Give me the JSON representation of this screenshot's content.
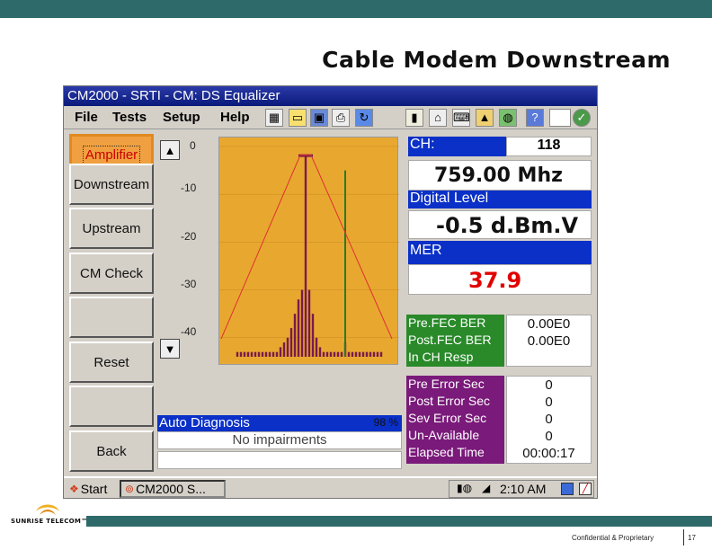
{
  "slide": {
    "title": "Cable Modem Downstream",
    "logo_text": "SUNRISE TELECOM™",
    "confidential": "Confidential & Proprietary",
    "page_number": "17"
  },
  "window": {
    "title": "CM2000 - SRTI - CM: DS Equalizer"
  },
  "menu": {
    "items": [
      "File",
      "Tests",
      "Setup",
      "Help"
    ]
  },
  "toolbar_icons": [
    "calculator-icon",
    "open-folder-icon",
    "save-disk-icon",
    "printer-icon",
    "refresh-icon",
    "chart-icon",
    "network-icon",
    "keyboard-icon",
    "lock-icon",
    "globe-icon",
    "help-icon",
    "checkmark-icon"
  ],
  "sidebar": {
    "buttons": [
      {
        "label": "Amplifier",
        "active": true
      },
      {
        "label": "Downstream"
      },
      {
        "label": "Upstream"
      },
      {
        "label": "CM Check"
      },
      {
        "label": ""
      },
      {
        "label": "Reset"
      },
      {
        "label": ""
      },
      {
        "label": "Back"
      }
    ]
  },
  "chart": {
    "y_ticks": [
      "0",
      "-10",
      "-20",
      "-30",
      "-40"
    ],
    "scroll_up": "▲",
    "scroll_down": "▼"
  },
  "chart_data": {
    "type": "bar",
    "ylim": [
      -44,
      0
    ],
    "ytick_values": [
      0,
      -10,
      -20,
      -30,
      -40
    ],
    "bar_color": "#7a1a4a",
    "marker_color": "#2a7a2a",
    "line_color": "#e03030",
    "values": [
      -43,
      -43,
      -43,
      -43,
      -43,
      -43,
      -43,
      -43,
      -43,
      -43,
      -43,
      -43,
      -42,
      -41,
      -40,
      -38,
      -35,
      -32,
      -30,
      -2,
      -30,
      -35,
      -40,
      -42,
      -43,
      -43,
      -43,
      -43,
      -43,
      -43,
      -41,
      -43,
      -43,
      -43,
      -43,
      -43,
      -43,
      -43,
      -43,
      -43,
      -43
    ],
    "marker_index": 30,
    "marker_value": -5
  },
  "diagnosis": {
    "header": "Auto Diagnosis",
    "percent": "98 %",
    "result": "No impairments"
  },
  "readings": {
    "ch_label": "CH:",
    "ch_value": "118",
    "frequency": "759.00 Mhz",
    "level_label": "Digital Level",
    "level_value": "-0.5 d.Bm.V",
    "mer_label": "MER",
    "mer_value": "37.9"
  },
  "ber": {
    "labels": [
      "Pre.FEC BER",
      "Post.FEC BER",
      "In CH Resp"
    ],
    "values": [
      "0.00E0",
      "0.00E0",
      ""
    ]
  },
  "errors": {
    "labels": [
      "Pre Error Sec",
      "Post Error Sec",
      "Sev Error Sec",
      "Un-Available",
      "Elapsed Time"
    ],
    "values": [
      "0",
      "0",
      "0",
      "0",
      "00:00:17"
    ]
  },
  "taskbar": {
    "start": "Start",
    "task": "CM2000   S...",
    "time": "2:10 AM"
  },
  "colors": {
    "teal": "#2f6a6a",
    "chart_bg": "#e8a830",
    "blue": "#0a30c8",
    "green": "#2a8a2a",
    "purple": "#7a1a7a",
    "mer_red": "#e00000"
  }
}
